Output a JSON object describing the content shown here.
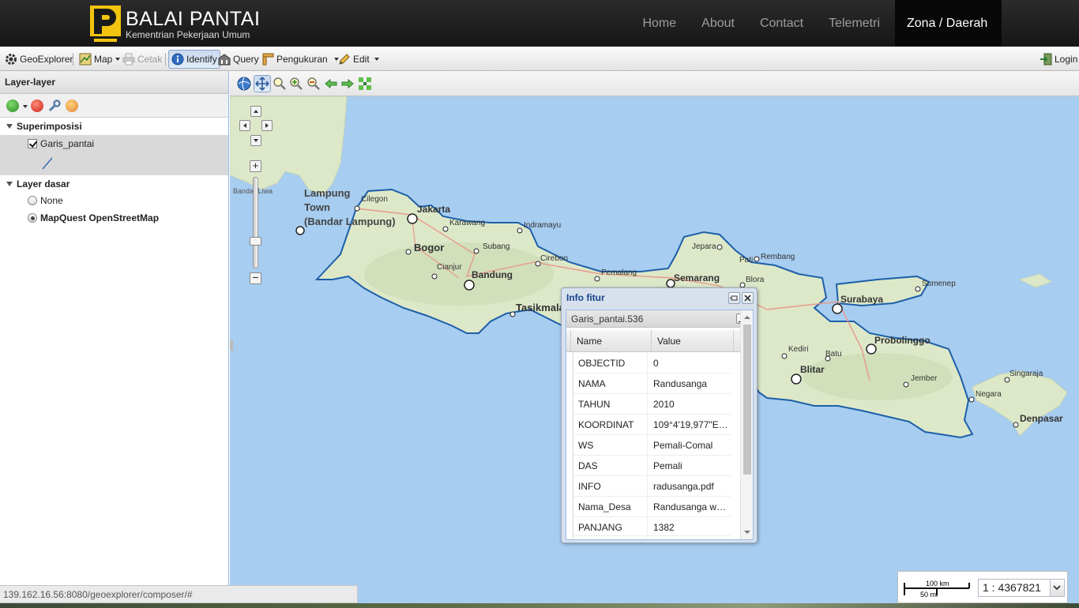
{
  "brand": {
    "title": "BALAI PANTAI",
    "subtitle": "Kementrian Pekerjaan Umum",
    "logo_color": "#f2c40f"
  },
  "nav": {
    "items": [
      "Home",
      "About",
      "Contact",
      "Telemetri"
    ],
    "active": "Zona / Daerah"
  },
  "toolbar": {
    "geoexplorer": "GeoExplorer",
    "map": "Map",
    "print": "Cetak",
    "identify": "Identify",
    "query": "Query",
    "measure": "Pengukuran",
    "edit": "Edit",
    "login": "Login"
  },
  "left_panel": {
    "title": "Layer-layer",
    "group_overlay": "Superimposisi",
    "overlay_layer": "Garis_pantai",
    "group_base": "Layer dasar",
    "base_none": "None",
    "base_mapquest": "MapQuest OpenStreetMap"
  },
  "map": {
    "water_color": "#a7cdf0",
    "land_color": "#dde8c9",
    "coastline_color": "#1d5fa8",
    "places": {
      "lampung": "Lampung",
      "lampung2": "Town",
      "lampung3": "(Bandar Lampung)",
      "bandar_liwa": "Bandar Liwa",
      "cilegon": "Cilegon",
      "jakarta": "Jakarta",
      "karawang": "Karawang",
      "indramayu": "Indramayu",
      "bogor": "Bogor",
      "subang": "Subang",
      "cianjur": "Cianjur",
      "bandung": "Bandung",
      "cirebon": "Cirebon",
      "tasikmalaya": "Tasikmala",
      "pemalang": "Pemalang",
      "jepara": "Jepara",
      "pati": "Pati",
      "rembang": "Rembang",
      "semarang": "Semarang",
      "blora": "Blora",
      "sumenep": "Sumenep",
      "surabaya": "Surabaya",
      "kediri": "Kediri",
      "batu": "Batu",
      "probolinggo": "Probolinggo",
      "blitar": "Blitar",
      "jember": "Jember",
      "singaraja": "Singaraja",
      "negara": "Negara",
      "denpasar": "Denpasar"
    }
  },
  "info_window": {
    "title": "Info fitur",
    "feature_id": "Garis_pantai.536",
    "col_name": "Name",
    "col_value": "Value",
    "rows": [
      {
        "name": "OBJECTID",
        "value": "0"
      },
      {
        "name": "NAMA",
        "value": "Randusanga"
      },
      {
        "name": "TAHUN",
        "value": "2010"
      },
      {
        "name": "KOORDINAT",
        "value": "109°4'19,977\"E 6..."
      },
      {
        "name": "WS",
        "value": "Pemali-Comal"
      },
      {
        "name": "DAS",
        "value": "Pemali"
      },
      {
        "name": "INFO",
        "value": "radusanga.pdf"
      },
      {
        "name": "Nama_Desa",
        "value": "Randusanga wet..."
      },
      {
        "name": "PANJANG",
        "value": "1382"
      }
    ]
  },
  "scale": {
    "km": "100 km",
    "mi": "50 mi",
    "ratio": "1 : 4367821"
  },
  "status_url": "139.162.16.56:8080/geoexplorer/composer/#"
}
